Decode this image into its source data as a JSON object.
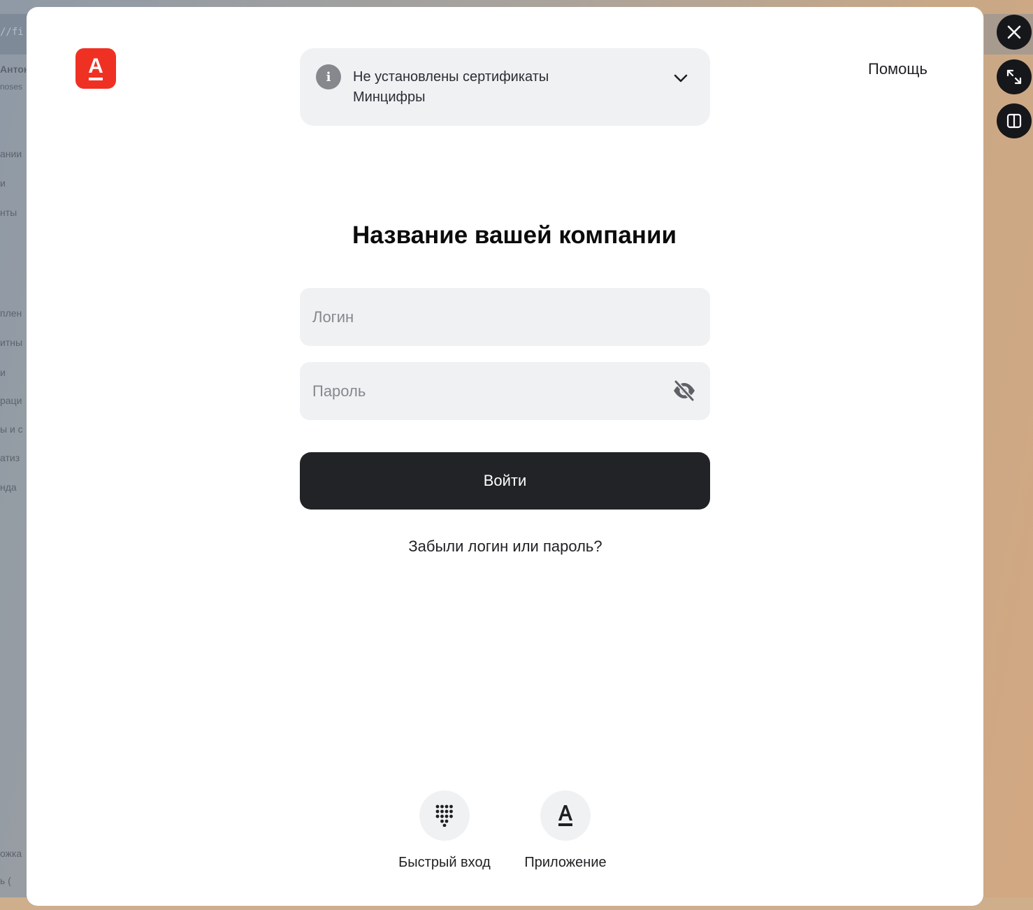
{
  "background": {
    "url_fragment": "//fi",
    "user_name": "Антон",
    "user_sub": "noses",
    "menu_fragments": [
      "ании",
      "и",
      "нты",
      "плен",
      "итны",
      "и",
      "раци",
      "ы и с",
      "атиз",
      "нда"
    ],
    "footer_fragments": [
      "ожка",
      "ь  ("
    ]
  },
  "header": {
    "logo_letter": "А",
    "help_label": "Помощь",
    "cert_notice": "Не установлены сертификаты Минцифры"
  },
  "form": {
    "title": "Название вашей компании",
    "login_placeholder": "Логин",
    "password_placeholder": "Пароль",
    "submit_label": "Войти",
    "forgot_label": "Забыли логин или пароль?"
  },
  "alt_login": [
    {
      "label": "Быстрый вход",
      "icon": "keypad-icon"
    },
    {
      "label": "Приложение",
      "icon": "app-logo-icon"
    }
  ],
  "icons": {
    "side_controls": [
      "close-icon",
      "expand-icon",
      "split-view-icon"
    ]
  },
  "colors": {
    "brand_red": "#ef3124",
    "button_dark": "#222326",
    "field_bg": "#f0f1f3",
    "muted_text": "#86888e"
  }
}
